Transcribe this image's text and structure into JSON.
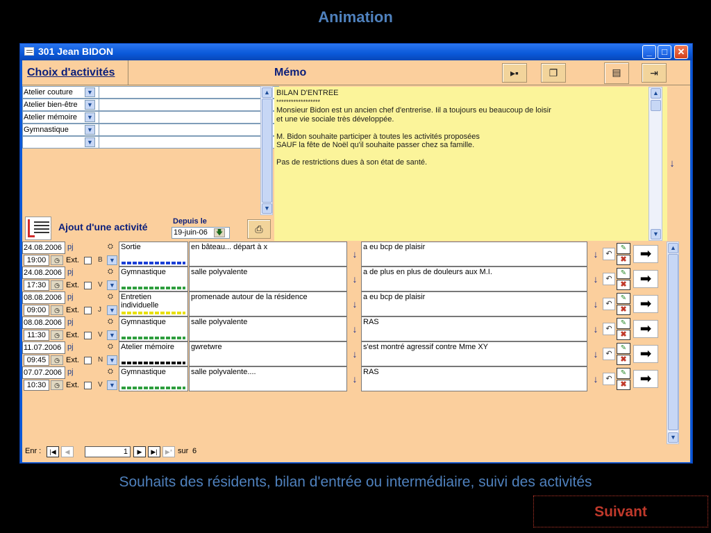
{
  "slide": {
    "title": "Animation",
    "caption": "Souhaits des résidents, bilan d'entrée ou intermédiaire, suivi des activités",
    "next_label": "Suivant"
  },
  "window": {
    "title": "301  Jean BIDON",
    "buttons": {
      "minimize": "_",
      "maximize": "□",
      "close": "✕"
    }
  },
  "header": {
    "choix_label": "Choix d'activités",
    "memo_label": "Mémo"
  },
  "activities": [
    {
      "name": "Atelier couture"
    },
    {
      "name": "Atelier bien-être"
    },
    {
      "name": "Atelier mémoire"
    },
    {
      "name": "Gymnastique"
    },
    {
      "name": ""
    }
  ],
  "memo_lines": [
    "BILAN D'ENTREE",
    "******************",
    "Monsieur Bidon est un ancien chef d'entrerise. Iil a toujours eu beaucoup de loisir",
    "et une vie sociale très développée.",
    "",
    "M. Bidon souhaite participer à toutes les activités proposées",
    "SAUF la fête de Noël qu'il souhaite passer chez sa famille.",
    "",
    "Pas de restrictions dues à son état de santé."
  ],
  "ajout": {
    "label": "Ajout d'une activité",
    "depuis_label": "Depuis le",
    "depuis_value": "19-juin-06"
  },
  "rows": [
    {
      "date": "24.08.2006",
      "pj": "pj",
      "time": "19:00",
      "ext": "Ext.",
      "code": "B",
      "activity": "Sortie",
      "bar_color": "#1a3fd6",
      "lieu": "en bâteau... départ à x",
      "obs": "a eu bcp de plaisir"
    },
    {
      "date": "24.08.2006",
      "pj": "pj",
      "time": "17:30",
      "ext": "Ext.",
      "code": "V",
      "activity": "Gymnastique",
      "bar_color": "#2e9e3e",
      "lieu": "salle polyvalente",
      "obs": "a de plus en plus de douleurs aux M.I."
    },
    {
      "date": "08.08.2006",
      "pj": "pj",
      "time": "09:00",
      "ext": "Ext.",
      "code": "J",
      "activity": "Entretien individuelle",
      "bar_color": "#e8e000",
      "lieu": "promenade autour de la résidence",
      "obs": "a eu bcp de plaisir"
    },
    {
      "date": "08.08.2006",
      "pj": "pj",
      "time": "11:30",
      "ext": "Ext.",
      "code": "V",
      "activity": "Gymnastique",
      "bar_color": "#2e9e3e",
      "lieu": "salle polyvalente",
      "obs": "RAS"
    },
    {
      "date": "11.07.2006",
      "pj": "pj",
      "time": "09:45",
      "ext": "Ext.",
      "code": "N",
      "activity": "Atelier mémoire",
      "bar_color": "#111111",
      "lieu": "gwretwre",
      "obs": "s'est montré agressif contre Mme XY"
    },
    {
      "date": "07.07.2006",
      "pj": "pj",
      "time": "10:30",
      "ext": "Ext.",
      "code": "V",
      "activity": "Gymnastique",
      "bar_color": "#2e9e3e",
      "lieu": "salle polyvalente....",
      "obs": "RAS"
    }
  ],
  "navigation": {
    "label": "Enr :",
    "current": "1",
    "total_label": "sur",
    "total": "6"
  }
}
